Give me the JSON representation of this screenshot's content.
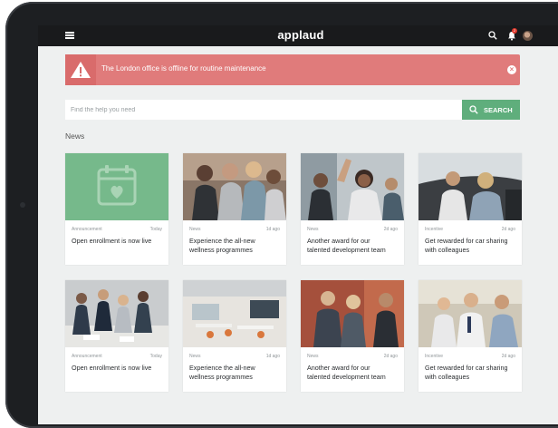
{
  "app": {
    "brand": "applaud",
    "unread_count": "2"
  },
  "colors": {
    "accent_green": "#5fae7c",
    "alert_red": "#e07b7b",
    "topbar": "#191a1c"
  },
  "alert": {
    "message": "The London office is offline for routine maintenance"
  },
  "search": {
    "placeholder": "Find the help you need",
    "button_label": "SEARCH"
  },
  "news": {
    "heading": "News",
    "cards": [
      {
        "category": "Announcement",
        "date": "Today",
        "title": "Open enrollment is now live",
        "image": "calendar-heart-icon"
      },
      {
        "category": "News",
        "date": "1d ago",
        "title": "Experience the all-new wellness programmes",
        "image": "fitness-group-photo"
      },
      {
        "category": "News",
        "date": "2d ago",
        "title": "Another award for our talented development team",
        "image": "team-highfive-photo"
      },
      {
        "category": "Incentive",
        "date": "2d ago",
        "title": "Get rewarded for car sharing with colleagues",
        "image": "car-sharing-photo"
      },
      {
        "category": "Announcement",
        "date": "Today",
        "title": "Open enrollment is now live",
        "image": "team-meeting-photo"
      },
      {
        "category": "News",
        "date": "1d ago",
        "title": "Experience the all-new wellness programmes",
        "image": "office-space-photo"
      },
      {
        "category": "News",
        "date": "2d ago",
        "title": "Another award for our talented development team",
        "image": "business-team-photo"
      },
      {
        "category": "Incentive",
        "date": "2d ago",
        "title": "Get rewarded for car sharing with colleagues",
        "image": "office-discussion-photo"
      }
    ]
  }
}
